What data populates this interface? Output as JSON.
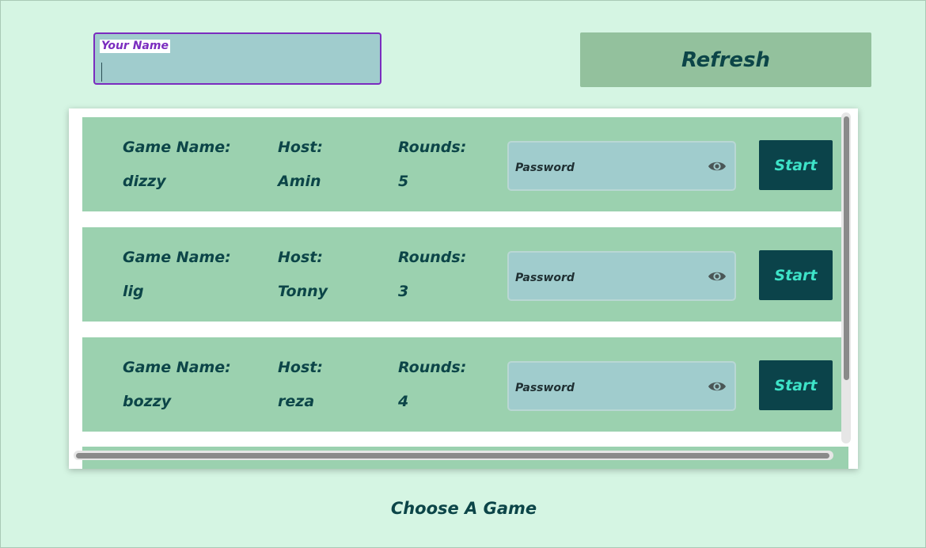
{
  "name_field": {
    "label": "Your Name",
    "value": ""
  },
  "refresh_label": "Refresh",
  "labels": {
    "game_name": "Game Name:",
    "host": "Host:",
    "rounds": "Rounds:"
  },
  "games": [
    {
      "name": "dizzy",
      "host": "Amin",
      "rounds": "5",
      "password_placeholder": "Password",
      "start_label": "Start"
    },
    {
      "name": "lig",
      "host": "Tonny",
      "rounds": "3",
      "password_placeholder": "Password",
      "start_label": "Start"
    },
    {
      "name": "bozzy",
      "host": "reza",
      "rounds": "4",
      "password_placeholder": "Password",
      "start_label": "Start"
    }
  ],
  "footer_title": "Choose A Game",
  "icons": {
    "password_toggle": "eye-icon"
  },
  "colors": {
    "background": "#d5f5e3",
    "card": "#9bd1af",
    "primary_dark": "#0b434a",
    "start_text": "#3ee3c8",
    "focus_border": "#7b2cbf",
    "input_bg": "#a0cccd",
    "refresh_bg": "#93c19d"
  }
}
